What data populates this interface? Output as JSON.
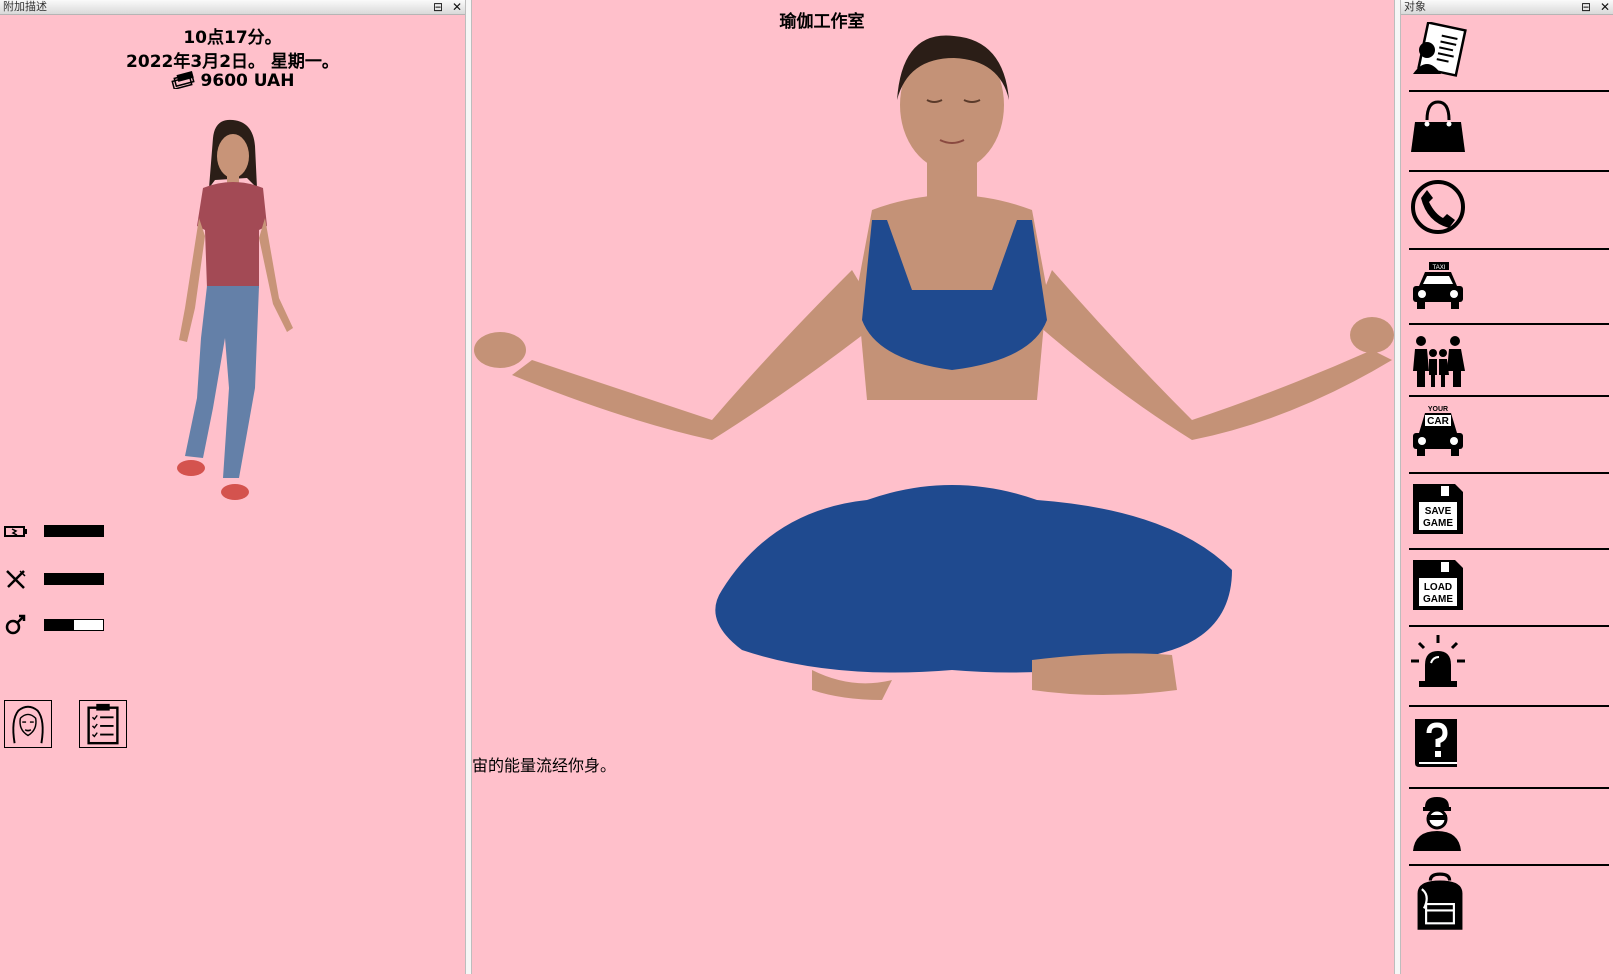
{
  "left_panel": {
    "title": "附加描述",
    "time": "10点17分。",
    "date": "2022年3月2日。 星期一。",
    "money": "9600 UAH",
    "bars": [
      {
        "icon": "battery-icon",
        "value": 1.0
      },
      {
        "icon": "utensils-icon",
        "value": 1.0
      },
      {
        "icon": "male-symbol-icon",
        "value": 0.5
      }
    ],
    "buttons": [
      "face-portrait-icon",
      "clipboard-checklist-icon"
    ]
  },
  "center": {
    "title": "瑜伽工作室",
    "text": "宙的能量流经你身。"
  },
  "right_panel": {
    "title": "对象",
    "items": [
      {
        "icon": "id-card-icon"
      },
      {
        "icon": "handbag-icon"
      },
      {
        "icon": "phone-icon"
      },
      {
        "icon": "taxi-icon",
        "label": "TAXI"
      },
      {
        "icon": "family-icon"
      },
      {
        "icon": "your-car-icon",
        "label_top": "YOUR",
        "label": "CAR"
      },
      {
        "icon": "save-game-icon",
        "label": "SAVE",
        "label2": "GAME"
      },
      {
        "icon": "load-game-icon",
        "label": "LOAD",
        "label2": "GAME"
      },
      {
        "icon": "siren-icon"
      },
      {
        "icon": "help-book-icon"
      },
      {
        "icon": "thief-icon"
      },
      {
        "icon": "backpack-icon"
      }
    ]
  },
  "window_buttons": {
    "restore": "⊟",
    "close": "✕"
  }
}
